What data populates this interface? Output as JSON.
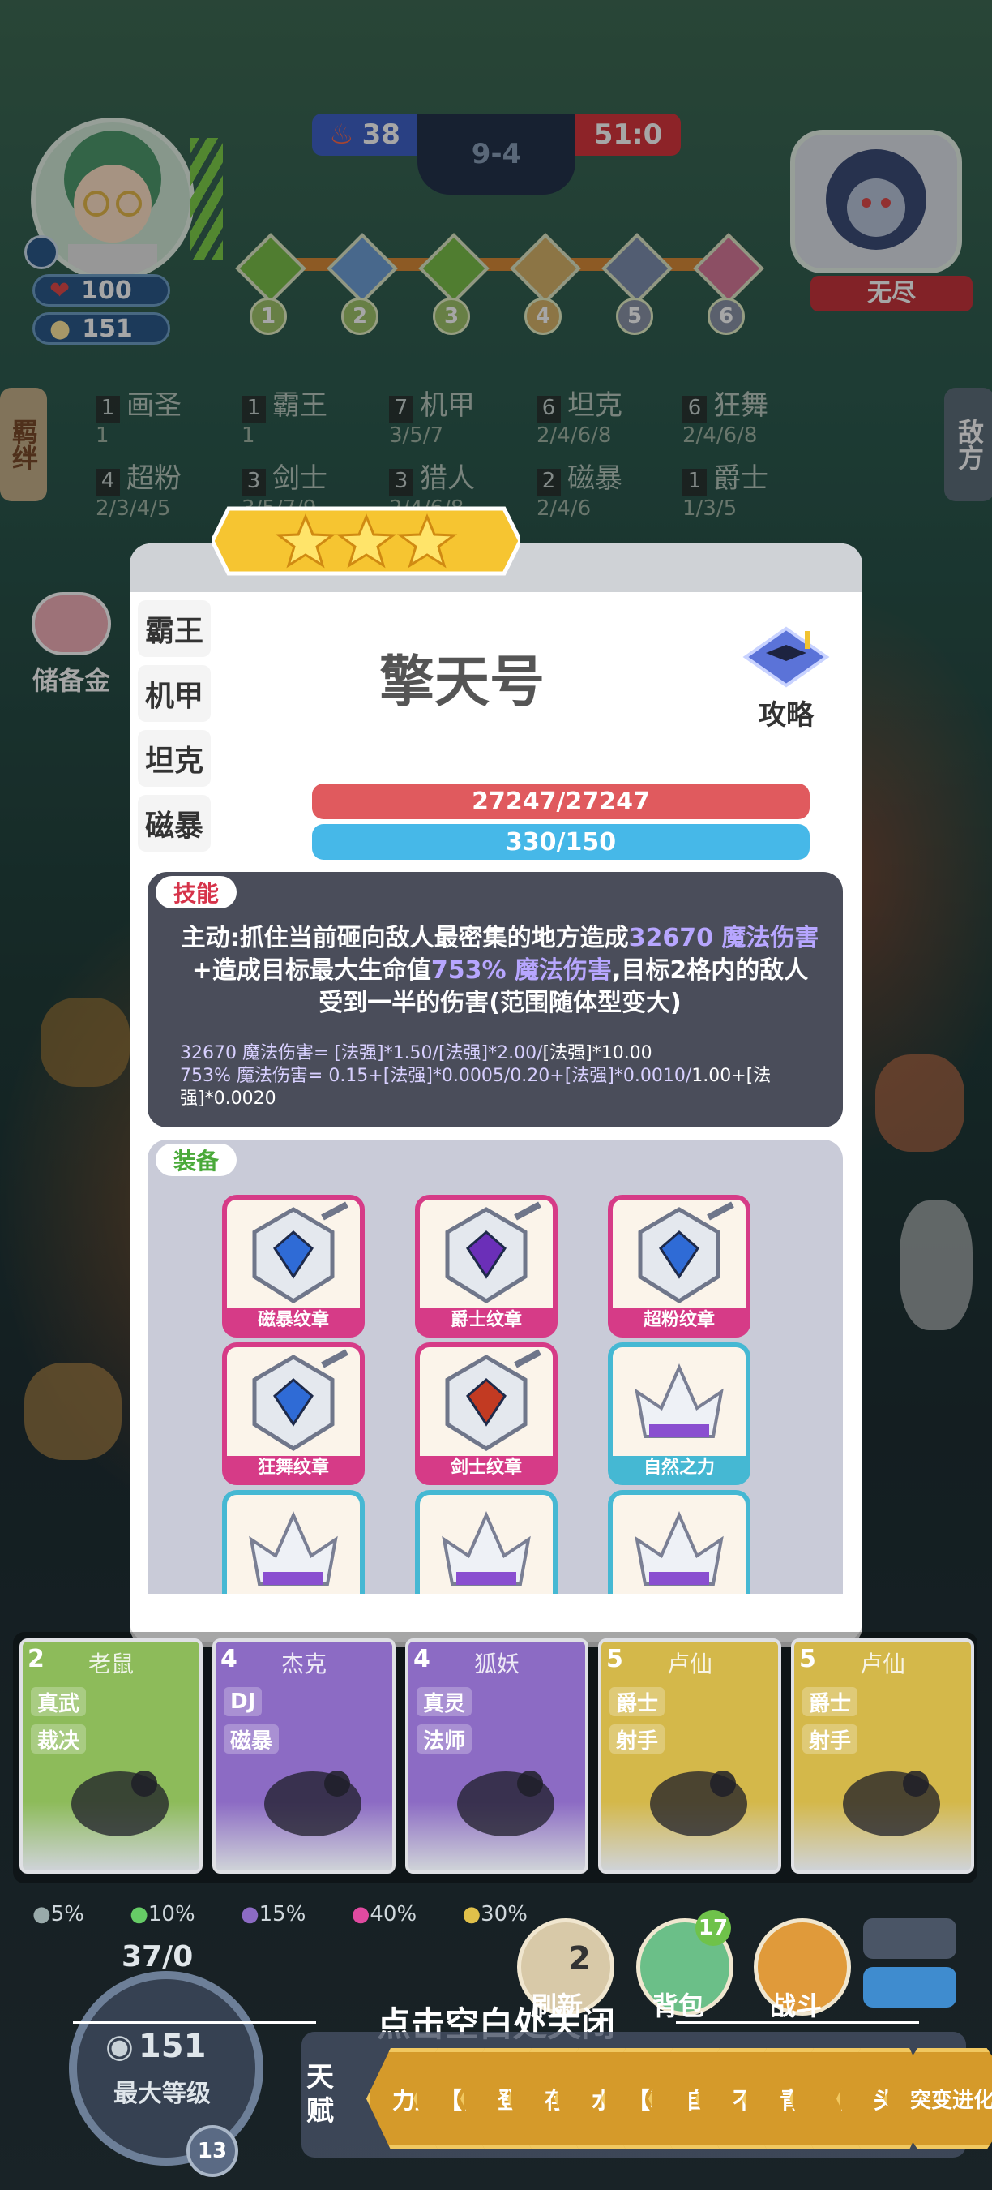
{
  "hud": {
    "hp": "100",
    "coins": "151",
    "score_left": "38",
    "stage": "9-4",
    "score_right": "51:0",
    "opponent_label": "无尽",
    "stage_nodes": [
      "1",
      "2",
      "3",
      "4",
      "5",
      "6"
    ],
    "left_tab": "羁绊",
    "right_tab": "敌方"
  },
  "synergies": [
    {
      "count": "1",
      "name": "画圣",
      "tiers": "1"
    },
    {
      "count": "1",
      "name": "霸王",
      "tiers": "1"
    },
    {
      "count": "7",
      "name": "机甲",
      "tiers": "3/5/7"
    },
    {
      "count": "6",
      "name": "坦克",
      "tiers": "2/4/6/8"
    },
    {
      "count": "6",
      "name": "狂舞",
      "tiers": "2/4/6/8"
    },
    {
      "count": "4",
      "name": "超粉",
      "tiers": "2/3/4/5"
    },
    {
      "count": "3",
      "name": "剑士",
      "tiers": "3/5/7/9"
    },
    {
      "count": "3",
      "name": "猎人",
      "tiers": "2/4/6/8"
    },
    {
      "count": "2",
      "name": "磁暴",
      "tiers": "2/4/6"
    },
    {
      "count": "1",
      "name": "爵士",
      "tiers": "1/3/5"
    }
  ],
  "savings_label": "储备金",
  "modal": {
    "unit_name": "擎天号",
    "guide_label": "攻略",
    "tabs": [
      "霸王",
      "机甲",
      "坦克",
      "磁暴"
    ],
    "hp_text": "27247/27247",
    "mana_text": "330/150",
    "skill_tag": "技能",
    "skill_desc_a": "主动:抓住当前砸向敌人最密集的地方造成",
    "skill_dmg1": "32670 魔法",
    "skill_desc_b": "伤害",
    "skill_desc_c": "+造成目标最大生命值",
    "skill_dmg2": "753% 魔法伤害",
    "skill_desc_d": ",目标2格内的敌人受到一半的伤害(范围随体型变大)",
    "formula1_a": "32670 魔法伤害= [法强]*1.50/[法强]*2.00/",
    "formula1_b": "[法强]*10.00",
    "formula2_a": "753% 魔法伤害= 0.15+[法强]*0.0005/0.20+[法强]*0.0010/",
    "formula2_b": "1.00+[法强]*0.0020",
    "equip_tag": "装备",
    "equipment": [
      {
        "name": "磁暴纹章",
        "gem": "#2f6bd6",
        "kind": "badge"
      },
      {
        "name": "爵士纹章",
        "gem": "#6b2fb8",
        "kind": "badge"
      },
      {
        "name": "超粉纹章",
        "gem": "#2f6bd6",
        "kind": "badge"
      },
      {
        "name": "狂舞纹章",
        "gem": "#2f6bd6",
        "kind": "badge"
      },
      {
        "name": "剑士纹章",
        "gem": "#c23a22",
        "kind": "badge"
      },
      {
        "name": "自然之力",
        "gem": "#8a4fd0",
        "kind": "crown"
      },
      {
        "name": "",
        "gem": "#8a4fd0",
        "kind": "crown"
      },
      {
        "name": "",
        "gem": "#8a4fd0",
        "kind": "crown"
      },
      {
        "name": "",
        "gem": "#8a4fd0",
        "kind": "crown"
      }
    ]
  },
  "shop": [
    {
      "cost": "2",
      "name": "老鼠",
      "traits": [
        "真武",
        "裁决"
      ],
      "color": "#8dbb5a"
    },
    {
      "cost": "4",
      "name": "杰克",
      "traits": [
        "DJ",
        "磁暴"
      ],
      "color": "#8c6bc4"
    },
    {
      "cost": "4",
      "name": "狐妖",
      "traits": [
        "真灵",
        "法师"
      ],
      "color": "#8c6bc4"
    },
    {
      "cost": "5",
      "name": "卢仙",
      "traits": [
        "爵士",
        "射手"
      ],
      "color": "#d4b84a"
    },
    {
      "cost": "5",
      "name": "卢仙",
      "traits": [
        "爵士",
        "射手"
      ],
      "color": "#d4b84a"
    }
  ],
  "odds": [
    "5%",
    "10%",
    "15%",
    "40%",
    "30%"
  ],
  "bottom": {
    "exp": "37/0",
    "coins": "151",
    "max_level_label": "最大等级",
    "level": "13",
    "refresh_cost": "2",
    "refresh_label": "刷新",
    "bag_count": "17",
    "bag_label": "背包",
    "battle_label": "战斗",
    "close_hint": "点击空白处关闭",
    "talent_title": "天赋",
    "talents": [
      "力量",
      "【恢",
      "登",
      "存",
      "水",
      "【装",
      "自",
      "不",
      "青",
      "【",
      "头",
      "突变进化"
    ]
  },
  "colors": {
    "hp_bar": "#e05a5e",
    "mana_bar": "#46b8e8",
    "skill_highlight": "#b7a6ff",
    "star": "#f6c531"
  }
}
